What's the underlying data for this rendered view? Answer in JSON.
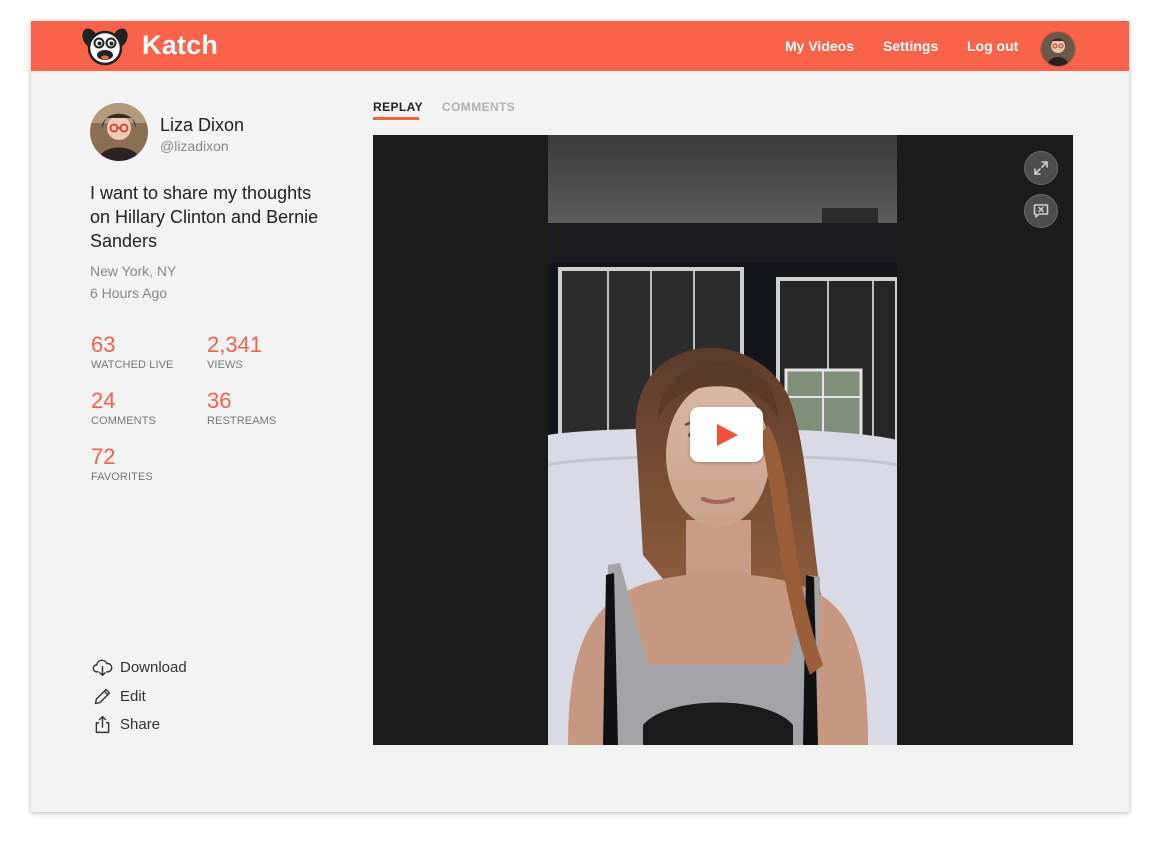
{
  "app": {
    "brand": "Katch",
    "nav": {
      "my_videos": "My Videos",
      "settings": "Settings",
      "logout": "Log out"
    },
    "colors": {
      "accent": "#fd634b",
      "stat": "#f0634d"
    }
  },
  "profile": {
    "name": "Liza Dixon",
    "handle": "@lizadixon"
  },
  "post": {
    "title": "I want to share my thoughts on Hillary Clinton and Bernie Sanders",
    "location": "New York, NY",
    "time": "6 Hours Ago"
  },
  "stats": [
    {
      "value": "63",
      "label": "WATCHED LIVE"
    },
    {
      "value": "2,341",
      "label": "VIEWS"
    },
    {
      "value": "24",
      "label": "COMMENTS"
    },
    {
      "value": "36",
      "label": "RESTREAMS"
    },
    {
      "value": "72",
      "label": "FAVORITES"
    }
  ],
  "actions": {
    "download": "Download",
    "edit": "Edit",
    "share": "Share"
  },
  "tabs": {
    "replay": "REPLAY",
    "comments": "COMMENTS"
  },
  "player": {
    "icons": [
      "expand-icon",
      "close-chat-icon",
      "play-icon"
    ]
  }
}
